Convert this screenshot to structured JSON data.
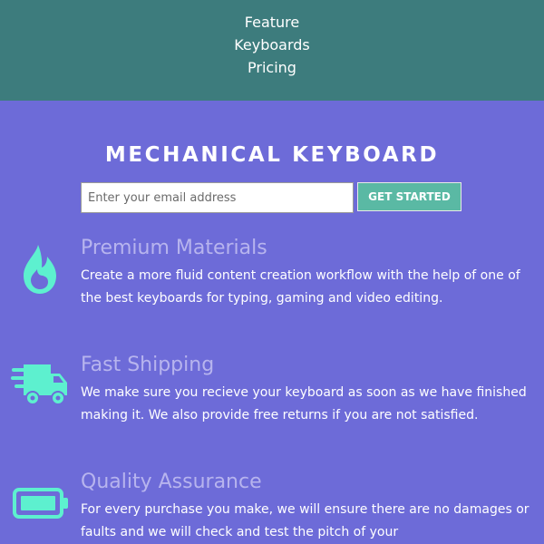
{
  "nav": {
    "items": [
      "Feature",
      "Keyboards",
      "Pricing"
    ]
  },
  "hero": {
    "title": "MECHANICAL KEYBOARD",
    "email_placeholder": "Enter your email address",
    "cta_label": "GET STARTED"
  },
  "features": [
    {
      "icon": "fire-icon",
      "title": "Premium Materials",
      "description": "Create a more fluid content creation workflow with the help of one of the best keyboards for typing, gaming and video editing."
    },
    {
      "icon": "shipping-truck-icon",
      "title": "Fast Shipping",
      "description": "We make sure you recieve your keyboard as soon as we have finished making it. We also provide free returns if you are not satisfied."
    },
    {
      "icon": "battery-icon",
      "title": "Quality Assurance",
      "description": "For every purchase you make, we will ensure there are no damages or faults and we will check and test the pitch of your"
    }
  ],
  "colors": {
    "nav_bg": "#3d7c7d",
    "page_bg": "#6d6bd8",
    "accent": "#5ab9a4",
    "icon": "#5df0cf",
    "feature_title": "#b7b4ee"
  }
}
